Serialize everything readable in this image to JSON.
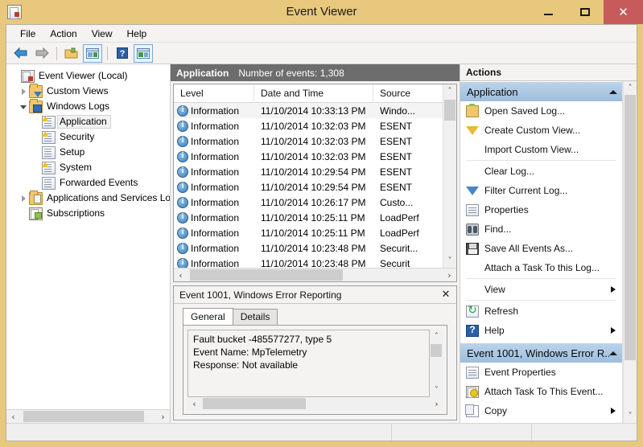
{
  "window": {
    "title": "Event Viewer",
    "icon": "event-viewer-icon",
    "controls": {
      "minimize": "–",
      "maximize": "□",
      "close": "✕"
    },
    "accent_titlebar": "#e8c87c",
    "accent_close": "#c75b5b"
  },
  "menubar": {
    "items": [
      "File",
      "Action",
      "View",
      "Help"
    ]
  },
  "toolbar": {
    "buttons": [
      {
        "name": "back-icon",
        "framed": false
      },
      {
        "name": "forward-icon",
        "framed": false
      },
      {
        "name": "open-folder-icon",
        "framed": false
      },
      {
        "name": "show-hide-console-tree-icon",
        "framed": true
      },
      {
        "name": "help-icon",
        "framed": false
      },
      {
        "name": "show-hide-action-pane-icon",
        "framed": true
      }
    ]
  },
  "tree": {
    "items": [
      {
        "label": "Event Viewer (Local)",
        "indent": 0,
        "expander": "none",
        "icon": "event-viewer-icon",
        "selected": false
      },
      {
        "label": "Custom Views",
        "indent": 1,
        "expander": "closed",
        "icon": "custom-views-folder-icon",
        "selected": false
      },
      {
        "label": "Windows Logs",
        "indent": 1,
        "expander": "open",
        "icon": "windows-logs-folder-icon",
        "selected": false
      },
      {
        "label": "Application",
        "indent": 2,
        "expander": "none",
        "icon": "log-warning-icon",
        "selected": true
      },
      {
        "label": "Security",
        "indent": 2,
        "expander": "none",
        "icon": "log-warning-icon",
        "selected": false
      },
      {
        "label": "Setup",
        "indent": 2,
        "expander": "none",
        "icon": "log-icon",
        "selected": false
      },
      {
        "label": "System",
        "indent": 2,
        "expander": "none",
        "icon": "log-warning-icon",
        "selected": false
      },
      {
        "label": "Forwarded Events",
        "indent": 2,
        "expander": "none",
        "icon": "log-icon",
        "selected": false
      },
      {
        "label": "Applications and Services Lo",
        "indent": 1,
        "expander": "closed",
        "icon": "services-folder-icon",
        "selected": false
      },
      {
        "label": "Subscriptions",
        "indent": 1,
        "expander": "none",
        "icon": "subscriptions-icon",
        "selected": false
      }
    ],
    "hscroll": {
      "left": "‹",
      "right": "›"
    }
  },
  "log": {
    "name": "Application",
    "event_count_text": "Number of events: 1,308",
    "columns": [
      "Level",
      "Date and Time",
      "Source"
    ],
    "rows": [
      {
        "level": "Information",
        "date": "11/10/2014 10:33:13 PM",
        "source": "Windo...",
        "selected": true
      },
      {
        "level": "Information",
        "date": "11/10/2014 10:32:03 PM",
        "source": "ESENT",
        "selected": false
      },
      {
        "level": "Information",
        "date": "11/10/2014 10:32:03 PM",
        "source": "ESENT",
        "selected": false
      },
      {
        "level": "Information",
        "date": "11/10/2014 10:32:03 PM",
        "source": "ESENT",
        "selected": false
      },
      {
        "level": "Information",
        "date": "11/10/2014 10:29:54 PM",
        "source": "ESENT",
        "selected": false
      },
      {
        "level": "Information",
        "date": "11/10/2014 10:29:54 PM",
        "source": "ESENT",
        "selected": false
      },
      {
        "level": "Information",
        "date": "11/10/2014 10:26:17 PM",
        "source": "Custo...",
        "selected": false
      },
      {
        "level": "Information",
        "date": "11/10/2014 10:25:11 PM",
        "source": "LoadPerf",
        "selected": false
      },
      {
        "level": "Information",
        "date": "11/10/2014 10:25:11 PM",
        "source": "LoadPerf",
        "selected": false
      },
      {
        "level": "Information",
        "date": "11/10/2014 10:23:48 PM",
        "source": "Securit...",
        "selected": false
      },
      {
        "level": "Information",
        "date": "11/10/2014 10:23:48 PM",
        "source": "Securit",
        "selected": false
      }
    ],
    "scroll": {
      "up": "˄",
      "down": "˅",
      "left": "‹",
      "right": "›"
    }
  },
  "details": {
    "title": "Event 1001, Windows Error Reporting",
    "close": "✕",
    "tabs": [
      {
        "label": "General",
        "active": true
      },
      {
        "label": "Details",
        "active": false
      }
    ],
    "lines": [
      "Fault bucket -485577277, type 5",
      "Event Name: MpTelemetry",
      "Response: Not available"
    ],
    "scroll": {
      "up": "˄",
      "down": "˅",
      "left": "‹",
      "right": "›"
    }
  },
  "actions": {
    "title": "Actions",
    "groups": [
      {
        "header": "Application",
        "collapse_glyph": "caret-up",
        "items": [
          {
            "label": "Open Saved Log...",
            "icon": "open-saved-log-icon",
            "submenu": false,
            "sep_after": false
          },
          {
            "label": "Create Custom View...",
            "icon": "create-custom-view-icon",
            "submenu": false,
            "sep_after": false
          },
          {
            "label": "Import Custom View...",
            "icon": "none",
            "submenu": false,
            "sep_after": true
          },
          {
            "label": "Clear Log...",
            "icon": "none",
            "submenu": false,
            "sep_after": false
          },
          {
            "label": "Filter Current Log...",
            "icon": "filter-current-log-icon",
            "submenu": false,
            "sep_after": false
          },
          {
            "label": "Properties",
            "icon": "properties-icon",
            "submenu": false,
            "sep_after": false
          },
          {
            "label": "Find...",
            "icon": "find-icon",
            "submenu": false,
            "sep_after": false
          },
          {
            "label": "Save All Events As...",
            "icon": "save-icon",
            "submenu": false,
            "sep_after": false
          },
          {
            "label": "Attach a Task To this Log...",
            "icon": "none",
            "submenu": false,
            "sep_after": true
          },
          {
            "label": "View",
            "icon": "none",
            "submenu": true,
            "sep_after": true
          },
          {
            "label": "Refresh",
            "icon": "refresh-icon",
            "submenu": false,
            "sep_after": false
          },
          {
            "label": "Help",
            "icon": "help-icon",
            "submenu": true,
            "sep_after": false
          }
        ]
      },
      {
        "header": "Event 1001, Windows Error R...",
        "collapse_glyph": "caret-up",
        "items": [
          {
            "label": "Event Properties",
            "icon": "properties-icon",
            "submenu": false,
            "sep_after": false
          },
          {
            "label": "Attach Task To This Event...",
            "icon": "attach-task-icon",
            "submenu": false,
            "sep_after": false
          },
          {
            "label": "Copy",
            "icon": "copy-icon",
            "submenu": true,
            "sep_after": false
          }
        ]
      }
    ],
    "scroll": {
      "up": "˄",
      "down": "˅"
    }
  },
  "statusbar": {
    "cells": [
      "",
      "",
      ""
    ]
  }
}
